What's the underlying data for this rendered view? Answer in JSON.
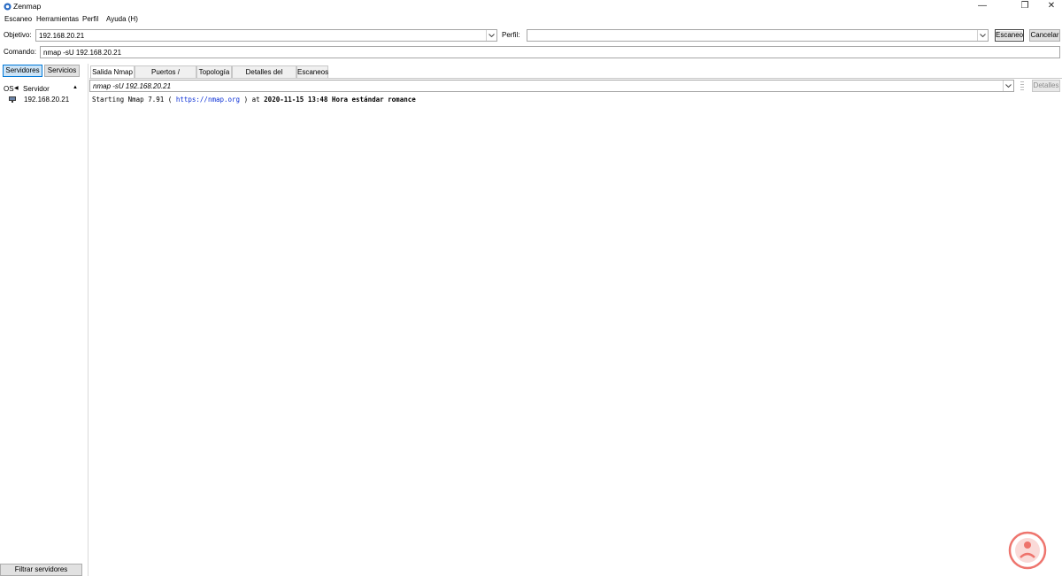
{
  "window": {
    "title": "Zenmap",
    "minimize": "—",
    "restore": "❐",
    "close": "✕"
  },
  "menu": {
    "items": [
      "Escaneo",
      "Herramientas",
      "Perfil",
      "Ayuda (H)"
    ]
  },
  "target": {
    "label": "Objetivo:",
    "value": "192.168.20.21"
  },
  "profile": {
    "label": "Perfil:",
    "value": ""
  },
  "buttons": {
    "scan": "Escaneo",
    "cancel": "Cancelar"
  },
  "command": {
    "label": "Comando:",
    "value": "nmap -sU 192.168.20.21"
  },
  "sidebar": {
    "tabs": [
      "Servidores",
      "Servicios"
    ],
    "columns": {
      "os": "OS",
      "host": "Servidor"
    },
    "hosts": [
      "192.168.20.21"
    ],
    "filter_button": "Filtrar servidores"
  },
  "main": {
    "tabs": [
      "Salida Nmap",
      "Puertos / Servidores",
      "Topología",
      "Detalles del servidor",
      "Escaneos"
    ],
    "output_combo": "nmap -sU 192.168.20.21",
    "details_button": "Detalles",
    "output": {
      "prefix": "Starting Nmap 7.91 ( ",
      "link": "https://nmap.org",
      "middle": " ) at ",
      "timestamp": "2020-11-15 13:48 Hora estándar romance",
      "suffix": ""
    }
  },
  "colors": {
    "accent": "#0078d7",
    "link": "#0a2fd6",
    "watermark": "#e8473e"
  }
}
